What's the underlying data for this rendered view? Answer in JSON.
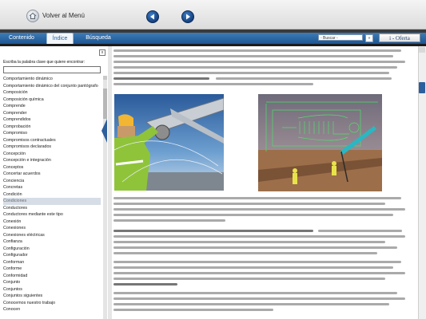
{
  "topbar": {
    "menu_label": "Volver al Menú"
  },
  "tabs": [
    {
      "label": "Contenido"
    },
    {
      "label": "Índice"
    },
    {
      "label": "Búsqueda"
    }
  ],
  "search": {
    "select_value": "- Buscar -",
    "go_label": "»"
  },
  "ioferta_label": "i - Oferta",
  "index_panel": {
    "close_label": "x",
    "prompt": "Escriba la palabra clave que quiere encontrar:",
    "filter_value": "",
    "selected": "Condiciones",
    "words": [
      "Comportamiento dinámico",
      "Comportamiento dinámico del conjunto pantógrafo",
      "Composición",
      "Composición química",
      "Comprende",
      "Comprender",
      "Comprendidos",
      "Comprobación",
      "Compromiso",
      "Compromisos contractuales",
      "Compromisos declarados",
      "Concepción",
      "Concepción e integración",
      "Conceptos",
      "Concertar acuerdos",
      "Conciencia",
      "Concretas",
      "Condición",
      "Condiciones",
      "Conductores",
      "Conductores mediante este tipo",
      "Conexión",
      "Conexiones",
      "Conexiones eléctricas",
      "Confianza",
      "Configuración",
      "Configurador",
      "Conforman",
      "Conforme",
      "Conformidad",
      "Conjunto",
      "Conjuntos",
      "Conjuntos siguientes",
      "Conocemos nuestro trabajo",
      "Conocen"
    ]
  },
  "colors": {
    "tab_bar": "#2a67a6",
    "nav_button": "#1a4a8a",
    "selected_row": "#d6dde6",
    "scroll_thumb": "#2b5f9e"
  },
  "icons": [
    "home-icon",
    "arrow-left-icon",
    "arrow-right-icon",
    "close-icon"
  ]
}
